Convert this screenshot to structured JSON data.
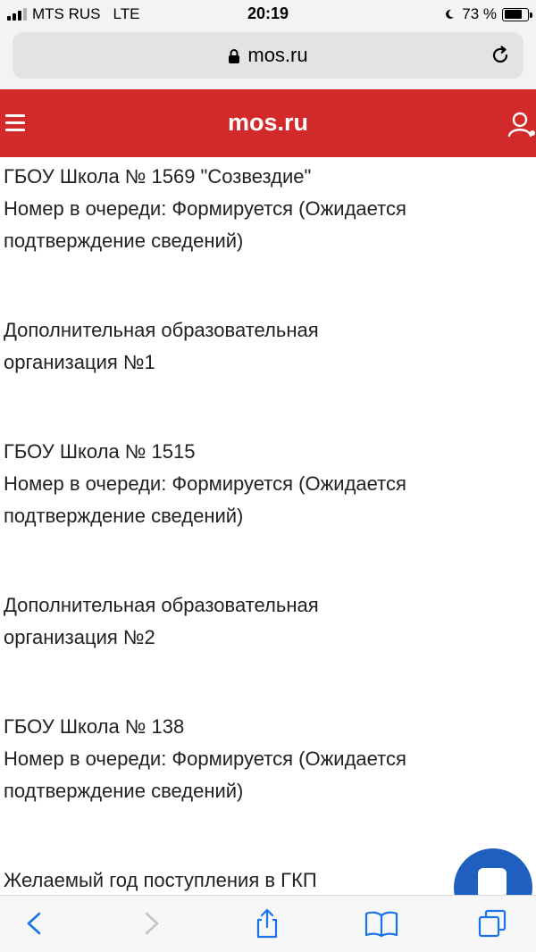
{
  "status_bar": {
    "carrier": "MTS RUS",
    "network": "LTE",
    "time": "20:19",
    "battery_percent": "73 %",
    "signal_bars": 4,
    "signal_bars_active": 3
  },
  "browser": {
    "url": "mos.ru",
    "icons": [
      "lock-icon",
      "reload-icon"
    ]
  },
  "header": {
    "title": "mos.ru",
    "background_color": "#d22a2a",
    "icons": [
      "menu-icon",
      "user-icon"
    ]
  },
  "entries": [
    {
      "title": "ГБОУ Школа № 1569 \"Созвездие\"",
      "lines": [
        "Номер в очереди: Формируется (Ожидается",
        "подтверждение сведений)"
      ]
    },
    {
      "title": "Дополнительная образовательная",
      "lines": [
        "организация №1"
      ]
    },
    {
      "title": "ГБОУ Школа № 1515",
      "lines": [
        "Номер в очереди: Формируется (Ожидается",
        "подтверждение сведений)"
      ]
    },
    {
      "title": "Дополнительная образовательная",
      "lines": [
        "организация №2"
      ]
    },
    {
      "title": "ГБОУ Школа № 138",
      "lines": [
        "Номер в очереди: Формируется (Ожидается",
        "подтверждение сведений)"
      ]
    },
    {
      "title": "Желаемый год поступления в ГКП",
      "lines": []
    }
  ],
  "chat_button": {
    "color": "#1f5fbf",
    "icon": "chat-icon"
  },
  "toolbar": {
    "icons": [
      "back-icon",
      "forward-icon",
      "share-icon",
      "bookmarks-icon",
      "tabs-icon"
    ],
    "accent_color": "#1a73e8"
  }
}
